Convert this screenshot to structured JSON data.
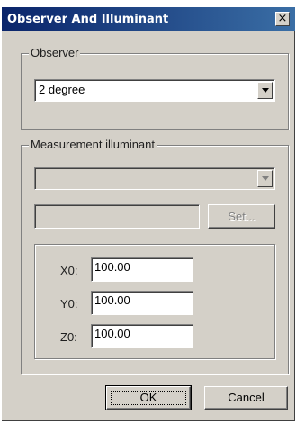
{
  "window": {
    "title": "Observer And Illuminant",
    "close_glyph": "×"
  },
  "observer": {
    "legend": "Observer",
    "selected": "2 degree"
  },
  "illuminant": {
    "legend": "Measurement illuminant",
    "selected": "",
    "text_value": "",
    "set_label": "Set...",
    "fields": [
      {
        "label": "X0:",
        "value": "100.00"
      },
      {
        "label": "Y0:",
        "value": "100.00"
      },
      {
        "label": "Z0:",
        "value": "100.00"
      }
    ]
  },
  "buttons": {
    "ok": "OK",
    "cancel": "Cancel"
  }
}
